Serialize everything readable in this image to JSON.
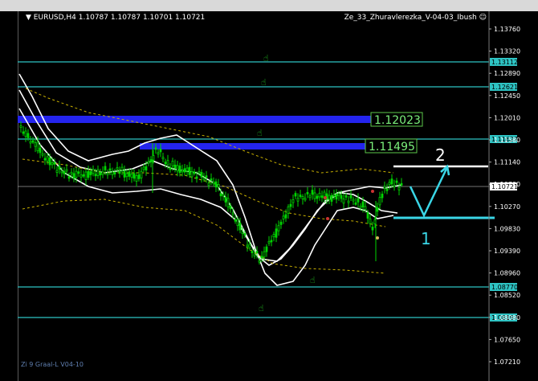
{
  "header": {
    "symbol": "EURUSD,H4",
    "ohlc": "1.10787 1.10787 1.10701 1.10721",
    "expert": "Ze_33_Zhuravlerezka_V-04-03_Ibush"
  },
  "footer": {
    "indicator": "Zi 9 Graal-L V04-10"
  },
  "price_axis": {
    "ticks": [
      "1.13760",
      "1.13320",
      "1.12890",
      "1.12450",
      "1.12010",
      "1.11580",
      "1.11140",
      "1.10700",
      "1.10270",
      "1.09830",
      "1.09390",
      "1.08960",
      "1.08520",
      "1.08080",
      "1.07650",
      "1.07210"
    ],
    "current": "1.10721",
    "level_tags": [
      "1.13112",
      "1.12621",
      "1.11627",
      "1.08770",
      "1.08197"
    ]
  },
  "zones": [
    {
      "label": "1.12023"
    },
    {
      "label": "1.11495"
    }
  ],
  "annotations": {
    "point_1": "1",
    "point_2": "2"
  },
  "colors": {
    "background": "#000000",
    "candle": "#00d400",
    "level_line": "#2ec4c4",
    "zone": "#2424ee",
    "annotation": "#3ad6e6",
    "band": "#ffffff",
    "ma_dashed": "#c8b000"
  }
}
